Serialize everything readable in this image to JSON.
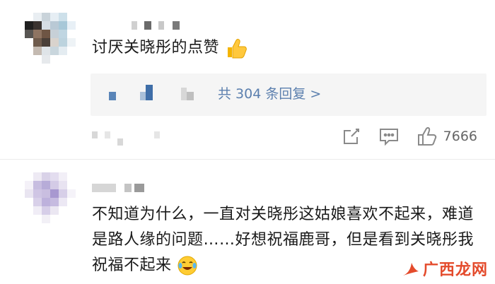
{
  "comments": [
    {
      "text": "讨厌关晓彤的点赞",
      "reply_link": "共 304 条回复 >",
      "like_count": "7666"
    },
    {
      "text": "不知道为什么，一直对关晓彤这姑娘喜欢不起来，难道是路人缘的问题……好想祝福鹿哥，但是看到关晓彤我祝福不起来"
    }
  ],
  "watermark": "广西龙网",
  "icons": {
    "thumbs_up_emoji": "thumbs-up-emoji-icon",
    "laugh_cry_emoji": "laugh-cry-emoji-icon",
    "share": "share-icon",
    "comment": "comment-icon",
    "like": "thumbs-up-icon"
  },
  "colors": {
    "reply_link": "#5b7fae",
    "meta": "#8a8a8a",
    "reply_bg": "#f5f5f5",
    "watermark": "#e44b2c"
  }
}
